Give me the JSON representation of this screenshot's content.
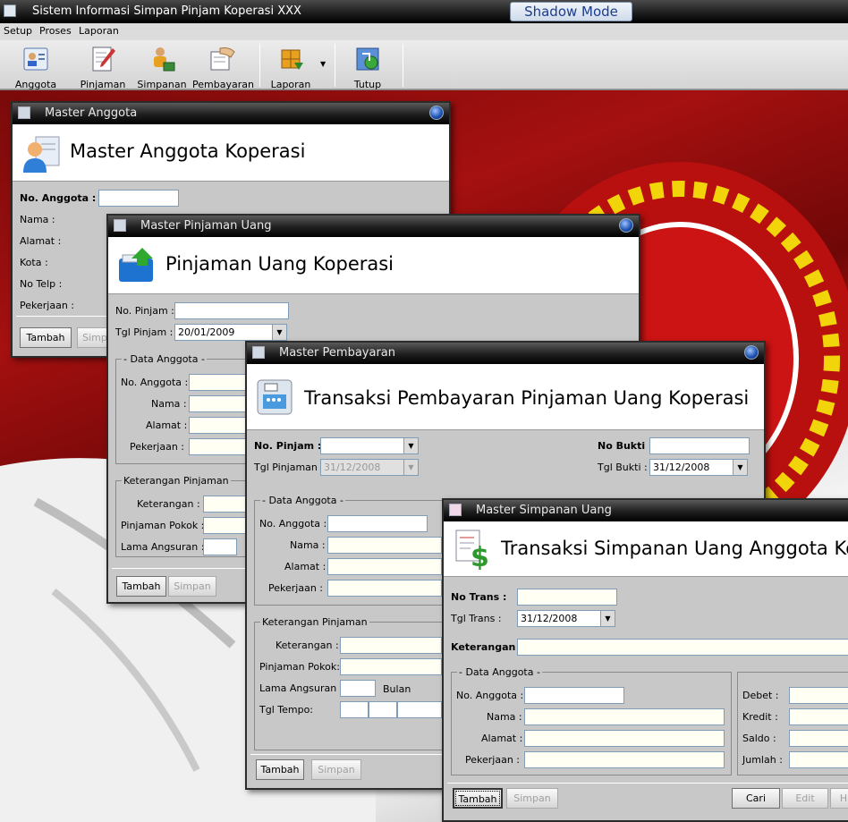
{
  "app": {
    "title": "Sistem Informasi Simpan Pinjam Koperasi XXX",
    "shadow_mode": "Shadow Mode"
  },
  "menu": [
    "Setup",
    "Proses",
    "Laporan"
  ],
  "toolbar": [
    {
      "label": "Anggota",
      "icon": "member-card-icon"
    },
    {
      "label": "Pinjaman",
      "icon": "document-pen-icon"
    },
    {
      "label": "Simpanan",
      "icon": "person-money-icon"
    },
    {
      "label": "Pembayaran",
      "icon": "hand-document-icon"
    },
    {
      "label": "Laporan",
      "icon": "boxes-icon"
    },
    {
      "label": "Tutup",
      "icon": "exit-icon"
    }
  ],
  "win_anggota": {
    "title": "Master Anggota",
    "header": "Master Anggota Koperasi",
    "labels": [
      "No. Anggota :",
      "Nama :",
      "Alamat :",
      "Kota :",
      "No Telp :",
      "Pekerjaan :"
    ],
    "btn_tambah": "Tambah",
    "btn_simpan": "Simp"
  },
  "win_pinjaman": {
    "title": "Master Pinjaman Uang",
    "header": "Pinjaman Uang Koperasi",
    "no_pinjam": "No. Pinjam :",
    "tgl_pinjam": "Tgl Pinjam :",
    "tgl_value": "20/01/2009",
    "grp_anggota": "- Data Anggota -",
    "anggota_labels": [
      "No. Anggota :",
      "Nama :",
      "Alamat :",
      "Pekerjaan :"
    ],
    "grp_ket": "Keterangan Pinjaman",
    "ket_labels": [
      "Keterangan :",
      "Pinjaman Pokok :",
      "Lama Angsuran :"
    ],
    "btn_tambah": "Tambah",
    "btn_simpan": "Simpan"
  },
  "win_pembayaran": {
    "title": "Master Pembayaran",
    "header": "Transaksi Pembayaran Pinjaman Uang Koperasi",
    "no_pinjam": "No. Pinjam :",
    "tgl_pinjaman": "Tgl Pinjaman :",
    "tgl_pinjaman_value": "31/12/2008",
    "no_bukti": "No Bukti :",
    "tgl_bukti": "Tgl Bukti :",
    "tgl_bukti_value": "31/12/2008",
    "grp_anggota": "- Data Anggota -",
    "anggota_labels": [
      "No. Anggota :",
      "Nama :",
      "Alamat :",
      "Pekerjaan :"
    ],
    "grp_ket": "Keterangan Pinjaman",
    "ket_labels": [
      "Keterangan :",
      "Pinjaman Pokok:",
      "Lama Angsuran :",
      "Tgl Tempo:"
    ],
    "bulan": "Bulan",
    "btn_tambah": "Tambah",
    "btn_simpan": "Simpan"
  },
  "win_simpanan": {
    "title": "Master Simpanan Uang",
    "header": "Transaksi Simpanan Uang Anggota  Kope",
    "no_trans": "No Trans :",
    "tgl_trans": "Tgl Trans :",
    "tgl_value": "31/12/2008",
    "keterangan": "Keterangan :",
    "grp_anggota": "- Data Anggota -",
    "anggota_labels": [
      "No. Anggota :",
      "Nama :",
      "Alamat :",
      "Pekerjaan :"
    ],
    "right_labels": [
      "Debet :",
      "Kredit :",
      "Saldo :",
      "Jumlah :"
    ],
    "btn_tambah": "Tambah",
    "btn_simpan": "Simpan",
    "btn_cari": "Cari",
    "btn_edit": "Edit",
    "btn_h": "H"
  }
}
